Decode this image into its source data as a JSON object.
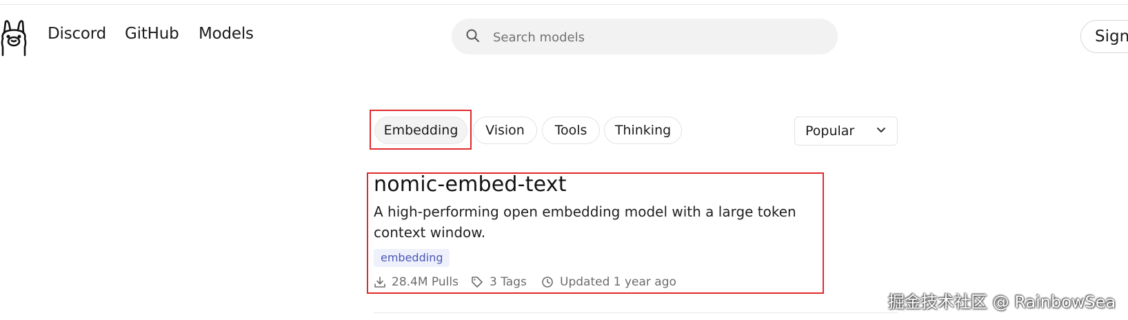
{
  "header": {
    "logo_icon": "llama-logo-icon",
    "nav": [
      {
        "label": "Discord"
      },
      {
        "label": "GitHub"
      },
      {
        "label": "Models"
      }
    ],
    "search": {
      "placeholder": "Search models",
      "value": "",
      "icon": "search-icon"
    },
    "signin_label": "Sign"
  },
  "filters": {
    "chips": [
      {
        "label": "Embedding",
        "active": true
      },
      {
        "label": "Vision",
        "active": false
      },
      {
        "label": "Tools",
        "active": false
      },
      {
        "label": "Thinking",
        "active": false
      }
    ],
    "sort": {
      "selected": "Popular",
      "icon": "chevron-down-icon"
    }
  },
  "model": {
    "name": "nomic-embed-text",
    "description": "A high-performing open embedding model with a large token context window.",
    "tag": "embedding",
    "pulls": "28.4M Pulls",
    "tags_count": "3 Tags",
    "updated": "Updated 1 year ago"
  },
  "colors": {
    "highlight": "#e0292b",
    "tag_bg": "#eef0fb",
    "tag_text": "#4b57b8"
  },
  "watermark": "掘金技术社区 @ RainbowSea"
}
